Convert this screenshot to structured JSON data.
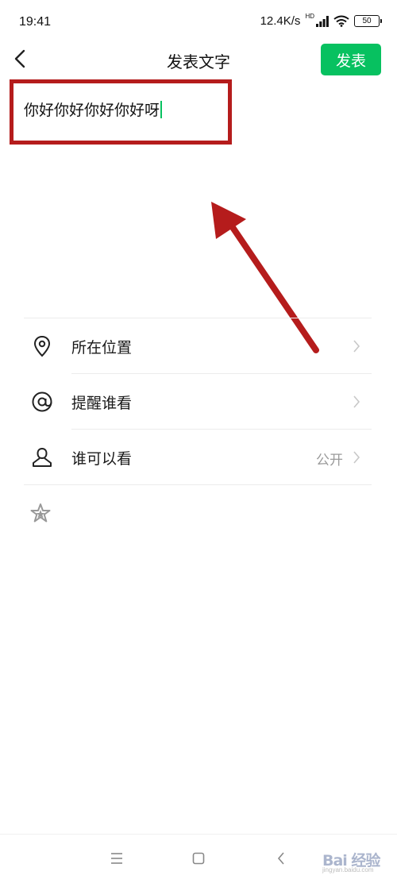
{
  "status_bar": {
    "time": "19:41",
    "network_speed": "12.4K/s",
    "network_type": "HD",
    "battery": "50",
    "icons": [
      "signal-icon",
      "wifi-icon",
      "battery-icon"
    ]
  },
  "header": {
    "title": "发表文字",
    "publish_label": "发表",
    "back_icon": "chevron-left-icon"
  },
  "compose": {
    "text": "你好你好你好你好呀"
  },
  "options": [
    {
      "icon": "location-pin-icon",
      "label": "所在位置",
      "value": ""
    },
    {
      "icon": "at-sign-icon",
      "label": "提醒谁看",
      "value": ""
    },
    {
      "icon": "person-icon",
      "label": "谁可以看",
      "value": "公开"
    }
  ],
  "extra_row": {
    "icon": "star-icon"
  },
  "nav_bar": {
    "icons": [
      "menu-icon",
      "home-square-icon",
      "back-chevron-icon"
    ]
  },
  "watermark": {
    "text": "Bai 经验",
    "sub": "jingyan.baidu.com"
  },
  "colors": {
    "accent_green": "#07c160",
    "annotation_red": "#b51c1c"
  }
}
